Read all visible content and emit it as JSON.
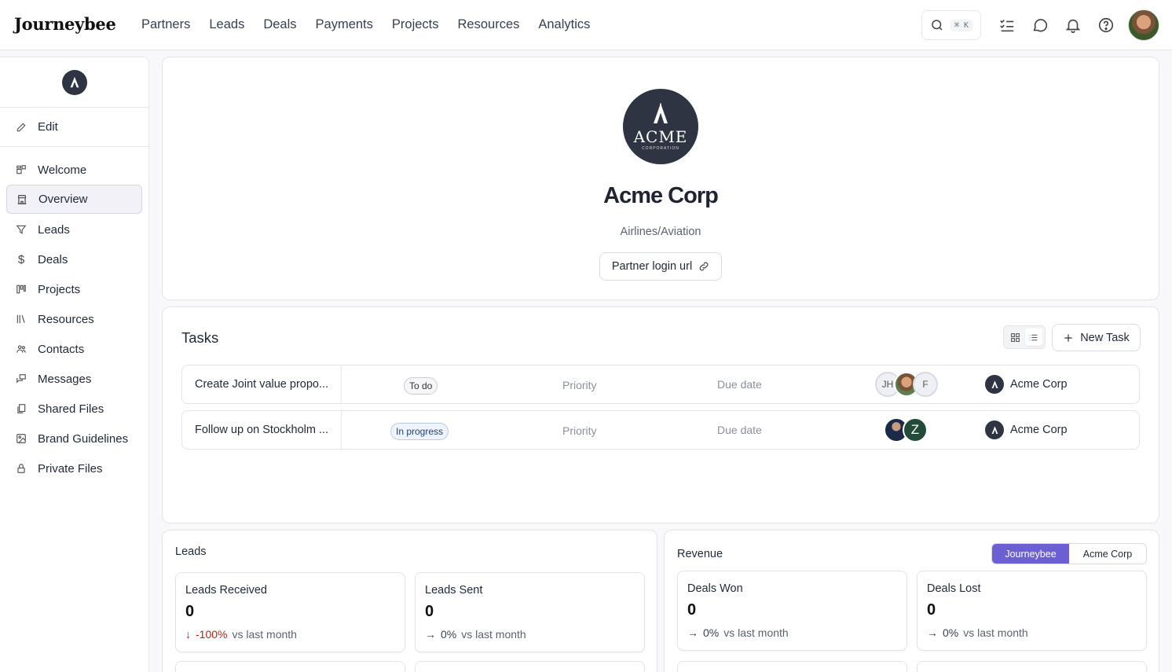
{
  "app": {
    "logo_text": "Journeybee"
  },
  "nav": {
    "links": [
      "Partners",
      "Leads",
      "Deals",
      "Payments",
      "Projects",
      "Resources",
      "Analytics"
    ],
    "search_shortcut": "⌘ K"
  },
  "sidebar": {
    "edit_label": "Edit",
    "items": [
      {
        "label": "Welcome",
        "icon": "welcome-icon"
      },
      {
        "label": "Overview",
        "icon": "building-icon",
        "active": true
      },
      {
        "label": "Leads",
        "icon": "funnel-icon"
      },
      {
        "label": "Deals",
        "icon": "dollar-icon"
      },
      {
        "label": "Projects",
        "icon": "projects-icon"
      },
      {
        "label": "Resources",
        "icon": "books-icon"
      },
      {
        "label": "Contacts",
        "icon": "people-icon"
      },
      {
        "label": "Messages",
        "icon": "messages-icon"
      },
      {
        "label": "Shared Files",
        "icon": "files-icon"
      },
      {
        "label": "Brand Guidelines",
        "icon": "image-icon"
      },
      {
        "label": "Private Files",
        "icon": "lock-icon"
      }
    ]
  },
  "profile": {
    "logo_main": "ACME",
    "logo_sub": "CORPORATION",
    "name": "Acme Corp",
    "industry": "Airlines/Aviation",
    "login_button": "Partner login url"
  },
  "tasks": {
    "title": "Tasks",
    "new_button": "New Task",
    "rows": [
      {
        "name": "Create Joint value propo...",
        "status": "To do",
        "priority": "Priority",
        "due": "Due date",
        "assignees": [
          "JH",
          "",
          "F"
        ],
        "company": "Acme Corp"
      },
      {
        "name": "Follow up on Stockholm ...",
        "status": "In progress",
        "priority": "Priority",
        "due": "Due date",
        "assignees": [
          "",
          "Z"
        ],
        "company": "Acme Corp"
      }
    ]
  },
  "leads": {
    "title": "Leads",
    "stats": [
      {
        "label": "Leads Received",
        "value": "0",
        "delta": "-100%",
        "delta_dir": "down",
        "suffix": "vs last month"
      },
      {
        "label": "Leads Sent",
        "value": "0",
        "delta": "0%",
        "delta_dir": "flat",
        "suffix": "vs last month"
      }
    ]
  },
  "revenue": {
    "title": "Revenue",
    "toggle": [
      "Journeybee",
      "Acme Corp"
    ],
    "toggle_selected": "Journeybee",
    "stats": [
      {
        "label": "Deals Won",
        "value": "0",
        "delta": "0%",
        "delta_dir": "flat",
        "suffix": "vs last month"
      },
      {
        "label": "Deals Lost",
        "value": "0",
        "delta": "0%",
        "delta_dir": "flat",
        "suffix": "vs last month"
      }
    ]
  },
  "colors": {
    "accent": "#6b5fd3",
    "brand_dark": "#2f3443",
    "negative": "#b42318"
  }
}
